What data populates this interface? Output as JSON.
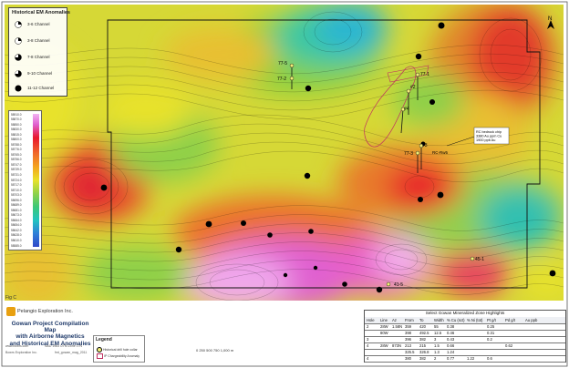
{
  "legend": {
    "title": "Historical EM Anomalies",
    "items": [
      {
        "label": "3-6 Channel",
        "fill": 0.25
      },
      {
        "label": "3-8 Channel",
        "fill": 0.4
      },
      {
        "label": "7-8 Channel",
        "fill": 0.6
      },
      {
        "label": "9-10 Channel",
        "fill": 0.8
      },
      {
        "label": "11-12 Channel",
        "fill": 1.0
      }
    ]
  },
  "colorbar": {
    "labels": [
      "58910.0",
      "58870.0",
      "58850.0",
      "58830.0",
      "58815.0",
      "58800.0",
      "58788.0",
      "58776.0",
      "58765.0",
      "58756.0",
      "58747.0",
      "58739.0",
      "58731.0",
      "58724.0",
      "58717.0",
      "58710.0",
      "58703.0",
      "58696.0",
      "58689.0",
      "58681.0",
      "58673.0",
      "58664.0",
      "58654.0",
      "58642.0",
      "58628.0",
      "58610.0",
      "58585.0"
    ]
  },
  "figure_label": "Fig C",
  "logo": {
    "company": "Pelangio Exploration Inc."
  },
  "title_block": {
    "title_lines": [
      "Gowan Project Compilation Map",
      "with Airborne Magnetics",
      "and Historical EM Anomalies"
    ],
    "line1": "www.bowrs.com",
    "line2": "Bowrs Exploration Inc.",
    "projection": "NAD 1983 UTM Zone 17N",
    "filename": "fmt_gowan_mag_2011"
  },
  "legend2": {
    "title": "Legend",
    "items": [
      "Historical drill hole collar",
      "IP Chargeability Anomaly"
    ]
  },
  "map_labels": {
    "t1": "77-5",
    "t2": "77-2",
    "t3": "77-1",
    "t4": "#2",
    "t5": "#3",
    "t6": "#4",
    "t7": "77-3",
    "t8": "RC-Rw5",
    "t9": "45-1",
    "t10": "41-5",
    "t11": "0"
  },
  "callout": {
    "lines": [
      "RC bedrock chip",
      "3380 Au ppm Cu",
      "1900 ppb Au"
    ]
  },
  "table": {
    "title": "Select Gowan Mineralized Zone Highlights",
    "headers": [
      "Hole",
      "Line",
      "Az",
      "From",
      "To",
      "Width",
      "% Cu (sct)",
      "% Ni (tot)",
      "Pt g/t",
      "Pd g/t",
      "Au ppb"
    ],
    "rows": [
      [
        "2",
        "28W",
        "1.58N",
        "359",
        "420",
        "55",
        "0.38",
        "",
        "0.25",
        "",
        ""
      ],
      [
        "",
        "80W",
        "",
        "398",
        "492.5",
        "12.5",
        "0.46",
        "",
        "0.31",
        "",
        ""
      ],
      [
        "3",
        "",
        "",
        "396",
        "382",
        "3",
        "0.43",
        "",
        "0.2",
        "",
        ""
      ],
      [
        "4",
        "28W",
        "873N",
        "213",
        "215",
        "1.5",
        "0.66",
        "",
        "",
        "0.62",
        ""
      ],
      [
        "",
        "",
        "",
        "325.5",
        "326.8",
        "1.3",
        "1.24",
        "",
        "",
        "",
        ""
      ],
      [
        "4",
        "",
        "",
        "380",
        "382",
        "2",
        "0.77",
        "1.22",
        "0.6",
        "",
        ""
      ]
    ]
  },
  "scale": {
    "label": "0  250  500  750  1,000 m"
  }
}
